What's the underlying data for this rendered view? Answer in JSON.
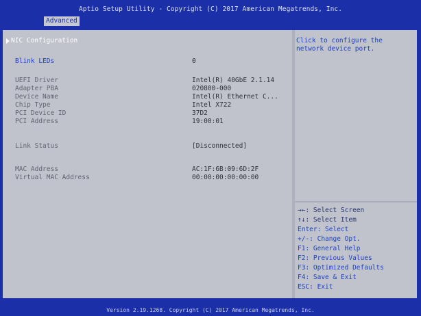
{
  "title": "Aptio Setup Utility - Copyright (C) 2017 American Megatrends, Inc.",
  "tab": "Advanced",
  "rows": {
    "nic_configuration": "NIC Configuration",
    "blink_leds_label": "Blink LEDs",
    "blink_leds_value": "0",
    "uefi_driver_label": "UEFI Driver",
    "uefi_driver_value": "Intel(R) 40GbE 2.1.14",
    "adapter_pba_label": "Adapter PBA",
    "adapter_pba_value": "020800-000",
    "device_name_label": "Device Name",
    "device_name_value": "Intel(R) Ethernet C...",
    "chip_type_label": "Chip Type",
    "chip_type_value": "Intel X722",
    "pci_device_id_label": "PCI Device ID",
    "pci_device_id_value": "37D2",
    "pci_address_label": "PCI Address",
    "pci_address_value": "19:00:01",
    "link_status_label": "Link Status",
    "link_status_value": "[Disconnected]",
    "mac_address_label": "MAC Address",
    "mac_address_value": "AC:1F:6B:09:6D:2F",
    "virtual_mac_label": "Virtual MAC Address",
    "virtual_mac_value": "00:00:00:00:00:00"
  },
  "help": {
    "description": "Click to configure the network device port.",
    "keys": [
      "→←: Select Screen",
      "↑↓: Select Item",
      "Enter: Select",
      "+/-: Change Opt.",
      "F1: General Help",
      "F2: Previous Values",
      "F3: Optimized Defaults",
      "F4: Save & Exit",
      "ESC: Exit"
    ]
  },
  "footer": "Version 2.19.1268. Copyright (C) 2017 American Megatrends, Inc."
}
